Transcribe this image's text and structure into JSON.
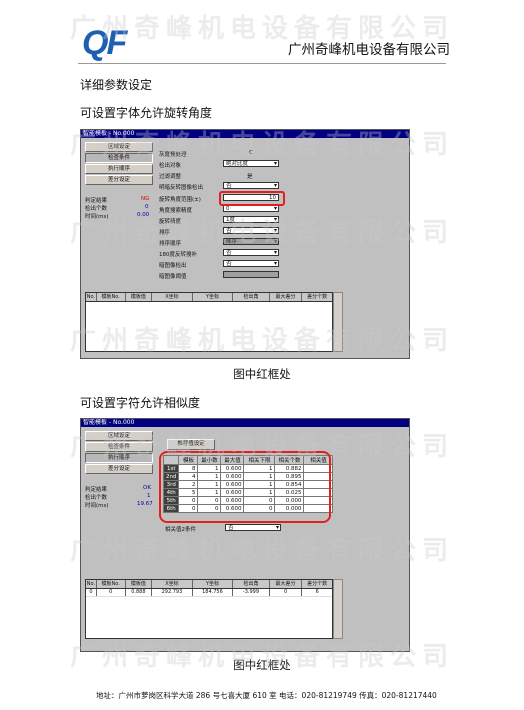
{
  "header": {
    "logo": "QF",
    "company": "广州奇峰机电设备有限公司"
  },
  "watermark": "广州奇峰机电设备有限公司",
  "headings": {
    "main": "详细参数设定",
    "section1": "可设置字体允许旋转角度",
    "section2": "可设置字符允许相似度"
  },
  "captions": {
    "first": "图中红框处",
    "second": "图中红框处"
  },
  "s1": {
    "title": "智能模板 - No.000",
    "buttons": [
      "区域设定",
      "检查条件",
      "执行顺序",
      "差分设定"
    ],
    "status": [
      {
        "label": "判定结果",
        "value": "NG"
      },
      {
        "label": "检出个数",
        "value": "0"
      },
      {
        "label": "时间(ms)",
        "value": "0.00"
      }
    ],
    "params": [
      {
        "label": "灰度预处理",
        "value": "C"
      },
      {
        "label": "检出对象",
        "value": "绝对比度"
      },
      {
        "label": "过滤调整",
        "value": "是"
      },
      {
        "label": "明暗反转图像检出",
        "value": "否"
      },
      {
        "label": "旋转角度范围(±)",
        "value": "10"
      },
      {
        "label": "角度搜索精度",
        "value": "0"
      },
      {
        "label": "旋转精度",
        "value": "1度"
      },
      {
        "label": "排序",
        "value": "否"
      },
      {
        "label": "排序顺序",
        "value": "降序"
      },
      {
        "label": "180度反转搜补",
        "value": "否"
      },
      {
        "label": "暗图像检出",
        "value": "否"
      },
      {
        "label": "暗图像阈值",
        "value": ""
      }
    ],
    "grid_headers": [
      "No.",
      "模板No.",
      "模板值",
      "X坐标",
      "Y坐标",
      "检出角",
      "最大差分",
      "差分个数"
    ]
  },
  "s2": {
    "title": "智能模板 - No.000",
    "buttons": [
      "区域设定",
      "检查条件",
      "执行顺序",
      "差分设定"
    ],
    "setting_button": "推荐值设定",
    "status": [
      {
        "label": "判定结果",
        "value": "OK"
      },
      {
        "label": "检出个数",
        "value": "1"
      },
      {
        "label": "时间(ms)",
        "value": "19.67"
      }
    ],
    "table_headers": [
      "",
      "模板",
      "最小数",
      "最大值",
      "相关下限",
      "相关个数",
      "相关值"
    ],
    "table_rows": [
      [
        "1st",
        "8",
        "1",
        "0.600",
        "1",
        "0.882"
      ],
      [
        "2nd",
        "4",
        "1",
        "0.600",
        "1",
        "0.895"
      ],
      [
        "3rd",
        "2",
        "1",
        "0.600",
        "1",
        "0.854"
      ],
      [
        "4th",
        "5",
        "1",
        "0.600",
        "1",
        "0.025"
      ],
      [
        "5th",
        "0",
        "0",
        "0.600",
        "0",
        "0.000"
      ],
      [
        "6th",
        "0",
        "0",
        "0.600",
        "0",
        "0.000"
      ]
    ],
    "corr_label": "相关值2条件",
    "corr_value": "否",
    "grid_headers": [
      "No.",
      "模板No.",
      "模板值",
      "X坐标",
      "Y坐标",
      "检出角",
      "最大差分",
      "差分个数"
    ],
    "grid_row": [
      "0",
      "0",
      "0.888",
      "292.793",
      "184.756",
      "-3.999",
      "0",
      "6"
    ]
  },
  "footer": "地址：广州市萝岗区科学大道 286 号七喜大厦 610 室    电话：020-81219749    传真：020-81217440"
}
